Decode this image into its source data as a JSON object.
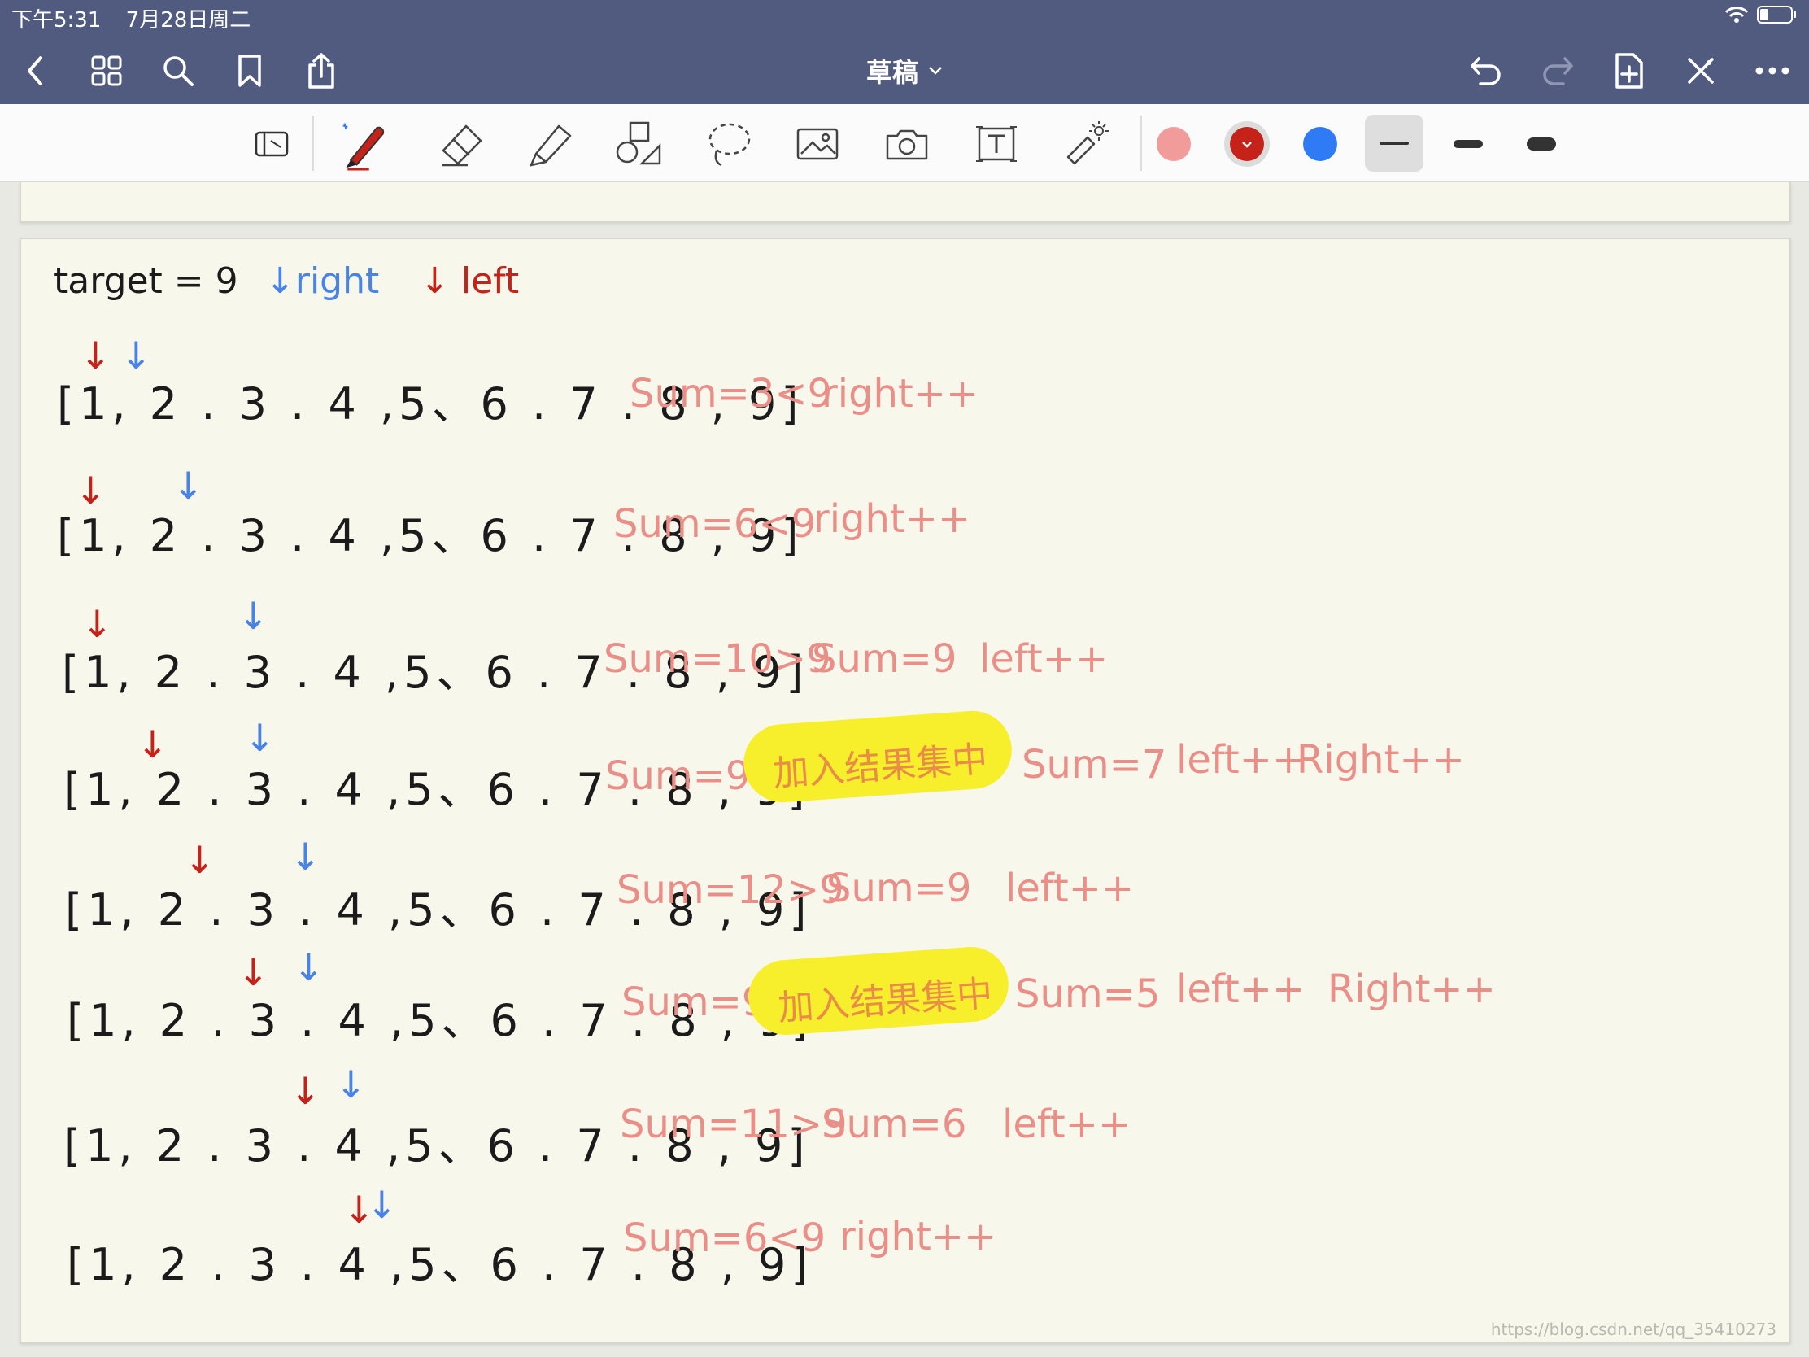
{
  "status_bar": {
    "time": "下午5:31",
    "date": "7月28日周二"
  },
  "nav": {
    "title": "草稿"
  },
  "colors": {
    "header": "#505b7f",
    "paper": "#f7f7ec",
    "swatch_pink": "#f19c9a",
    "swatch_red": "#c5221a",
    "swatch_blue": "#2f7bf5",
    "highlight": "#f8ef2c"
  },
  "icons": {
    "nav_left": [
      "back-icon",
      "grid-icon",
      "search-icon",
      "bookmark-icon",
      "share-icon"
    ],
    "nav_right": [
      "undo-icon",
      "redo-icon",
      "add-page-icon",
      "close-tools-icon",
      "more-icon"
    ],
    "tools": [
      "scan-icon",
      "pen-icon",
      "eraser-icon",
      "highlighter-icon",
      "shapes-icon",
      "lasso-icon",
      "image-icon",
      "camera-icon",
      "text-icon",
      "laser-pointer-icon"
    ]
  },
  "note": {
    "header": {
      "target": "target = 9",
      "right_label": "↓right",
      "left_label": "↓ left"
    },
    "array": "[1, 2 . 3 . 4 ,5、6 . 7 . 8 , 9]",
    "rows": [
      {
        "array": "[1, 2 . 3 . 4 ,5、6 . 7 . 8 , 9]",
        "notes": [
          "Sum=3<9",
          "right++"
        ]
      },
      {
        "array": "[1, 2 . 3 . 4 ,5、6 . 7 . 8 , 9]",
        "notes": [
          "Sum=6<9",
          "right++"
        ]
      },
      {
        "array": "[1, 2 . 3 . 4 ,5、6 . 7 . 8 , 9]",
        "notes": [
          "Sum=10>9",
          "Sum=9",
          "left++"
        ]
      },
      {
        "array": "[1, 2 . 3 . 4 ,5、6 . 7 . 8 , 9]",
        "notes": [
          "Sum=9",
          "Sum=7",
          "left++",
          "Right++"
        ],
        "highlight": "加入结果集中"
      },
      {
        "array": "[1, 2 . 3 . 4 ,5、6 . 7 . 8 , 9]",
        "notes": [
          "Sum=12>9",
          "Sum=9",
          "left++"
        ]
      },
      {
        "array": "[1, 2 . 3 . 4 ,5、6 . 7 . 8 , 9]",
        "notes": [
          "Sum=9",
          "Sum=5",
          "left++",
          "Right++"
        ],
        "highlight": "加入结果集中"
      },
      {
        "array": "[1, 2 . 3 . 4 ,5、6 . 7 . 8 , 9]",
        "notes": [
          "Sum=11>9",
          "Sum=6",
          "left++"
        ]
      },
      {
        "array": "[1, 2 . 3 . 4 ,5、6 . 7 . 8 , 9]",
        "notes": [
          "Sum=6<9",
          "right++"
        ]
      }
    ]
  },
  "watermark": "https://blog.csdn.net/qq_35410273"
}
